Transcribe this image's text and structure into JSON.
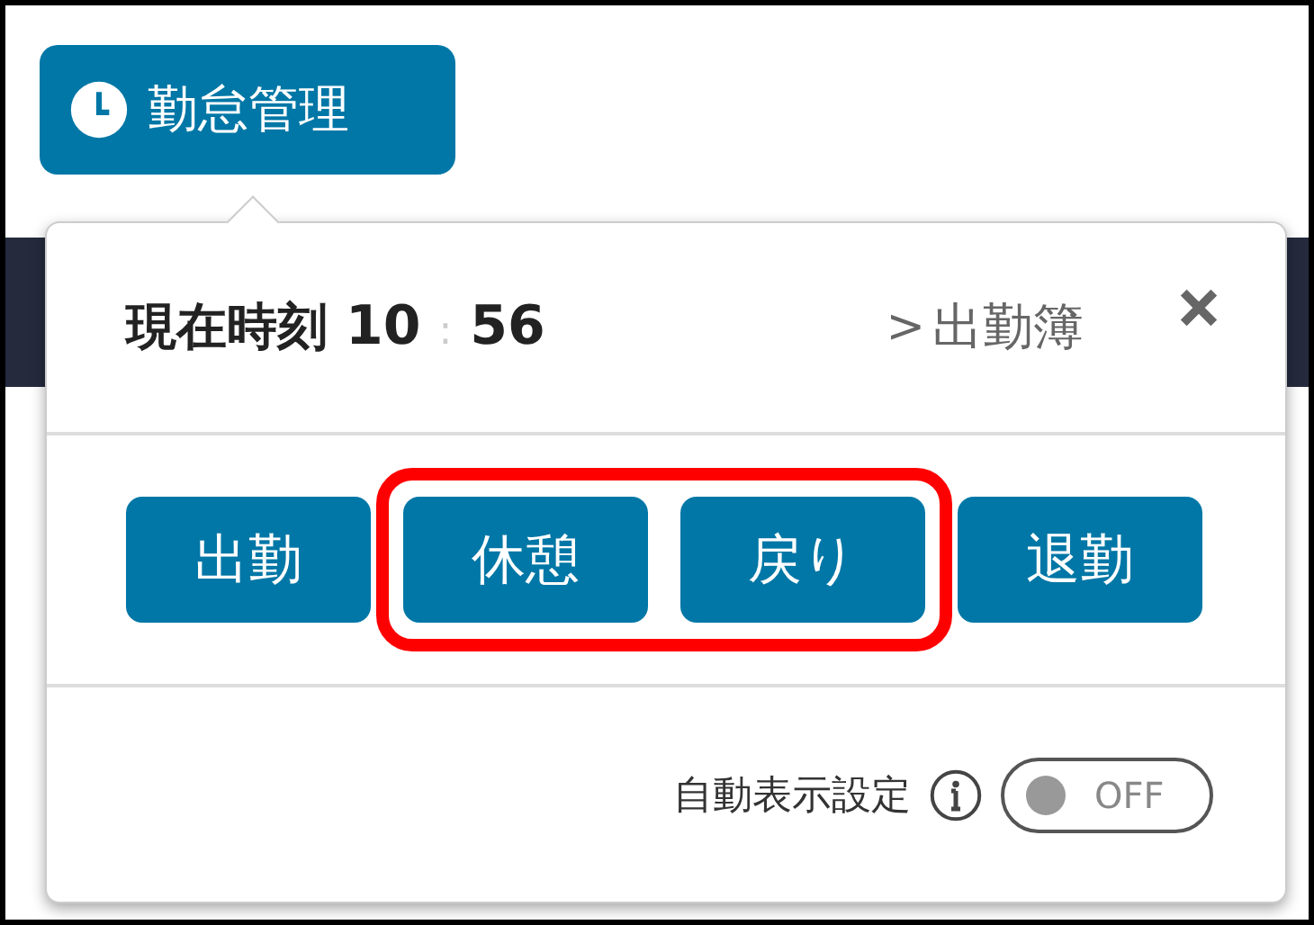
{
  "menu_button": {
    "label": "勤怠管理"
  },
  "popup": {
    "time_label": "現在時刻",
    "hours": "10",
    "separator": ":",
    "minutes": "56",
    "link": "出勤簿",
    "link_arrow": ">",
    "buttons": [
      {
        "label": "出勤",
        "highlighted": false
      },
      {
        "label": "休憩",
        "highlighted": true
      },
      {
        "label": "戻り",
        "highlighted": true
      },
      {
        "label": "退勤",
        "highlighted": false
      }
    ],
    "auto_display": {
      "label": "自動表示設定",
      "on": false,
      "state_text": "OFF"
    }
  }
}
